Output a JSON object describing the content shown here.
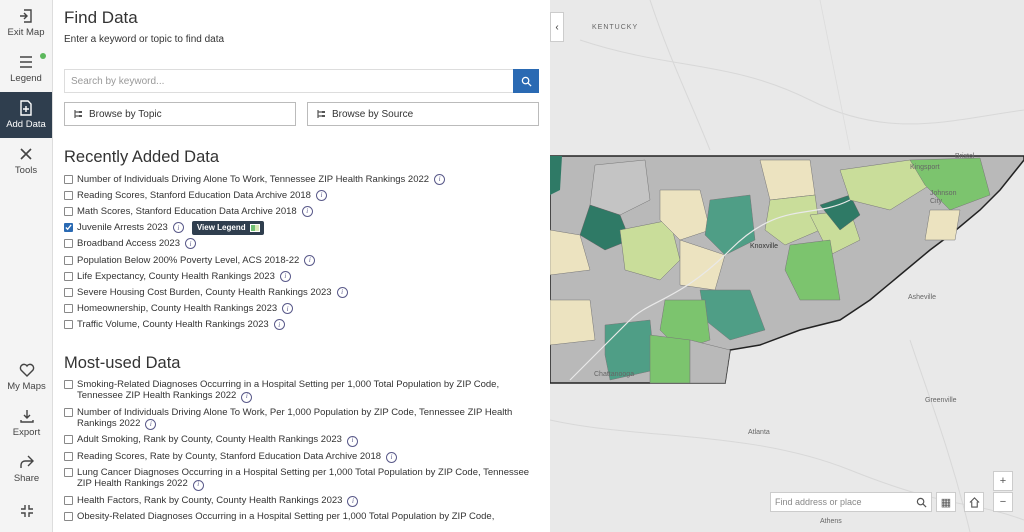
{
  "rail": {
    "items": [
      {
        "label": "Exit Map",
        "icon": "exit-icon"
      },
      {
        "label": "Legend",
        "icon": "list-icon"
      },
      {
        "label": "Add Data",
        "icon": "add-data-icon"
      },
      {
        "label": "Tools",
        "icon": "tools-icon"
      }
    ],
    "bottom": [
      {
        "label": "My Maps",
        "icon": "heart-icon"
      },
      {
        "label": "Export",
        "icon": "download-icon"
      },
      {
        "label": "Share",
        "icon": "share-icon"
      }
    ]
  },
  "panel": {
    "title": "Find Data",
    "subtitle": "Enter a keyword or topic to find data",
    "search_placeholder": "Search by keyword...",
    "browse_topic": "Browse by Topic",
    "browse_source": "Browse by Source",
    "recent_heading": "Recently Added Data",
    "view_legend": "View Legend",
    "recent": [
      {
        "label": "Number of Individuals Driving Alone To Work, Tennessee ZIP Health Rankings 2022",
        "checked": false
      },
      {
        "label": "Reading Scores, Stanford Education Data Archive 2018",
        "checked": false
      },
      {
        "label": "Math Scores, Stanford Education Data Archive 2018",
        "checked": false
      },
      {
        "label": "Juvenile Arrests 2023",
        "checked": true
      },
      {
        "label": "Broadband Access 2023",
        "checked": false
      },
      {
        "label": "Population Below 200% Poverty Level, ACS 2018-22",
        "checked": false
      },
      {
        "label": "Life Expectancy, County Health Rankings 2023",
        "checked": false
      },
      {
        "label": "Severe Housing Cost Burden, County Health Rankings 2023",
        "checked": false
      },
      {
        "label": "Homeownership, County Health Rankings 2023",
        "checked": false
      },
      {
        "label": "Traffic Volume, County Health Rankings 2023",
        "checked": false
      }
    ],
    "most_heading": "Most-used Data",
    "most": [
      {
        "label": "Smoking-Related Diagnoses Occurring in a Hospital Setting per 1,000 Total Population by ZIP Code, Tennessee ZIP Health Rankings 2022"
      },
      {
        "label": "Number of Individuals Driving Alone To Work, Per 1,000 Population by ZIP Code, Tennessee ZIP Health Rankings 2022"
      },
      {
        "label": "Adult Smoking, Rank by County, County Health Rankings 2023"
      },
      {
        "label": "Reading Scores, Rate by County, Stanford Education Data Archive 2018"
      },
      {
        "label": "Lung Cancer Diagnoses Occurring in a Hospital Setting per 1,000 Total Population by ZIP Code, Tennessee ZIP Health Rankings 2022"
      },
      {
        "label": "Health Factors, Rank by County, County Health Rankings 2023"
      },
      {
        "label": "Obesity-Related Diagnoses Occurring in a Hospital Setting per 1,000 Total Population by ZIP Code,"
      }
    ]
  },
  "map": {
    "labels": {
      "kentucky": "KENTUCKY",
      "bristol": "Bristol",
      "kingsport": "Kingsport",
      "johnson_city": "Johnson City",
      "knoxville": "Knoxville",
      "asheville": "Asheville",
      "chattanooga": "Chattanooga",
      "greenville": "Greenville",
      "atlanta": "Atlanta",
      "athens": "Athens"
    },
    "search_placeholder": "Find address or place",
    "colors": {
      "grey": "#b9b9b9",
      "tan": "#ece3c0",
      "light_green": "#c9dd9a",
      "green": "#7cc46e",
      "teal": "#4f9e86",
      "dark_teal": "#2f7a66"
    }
  }
}
